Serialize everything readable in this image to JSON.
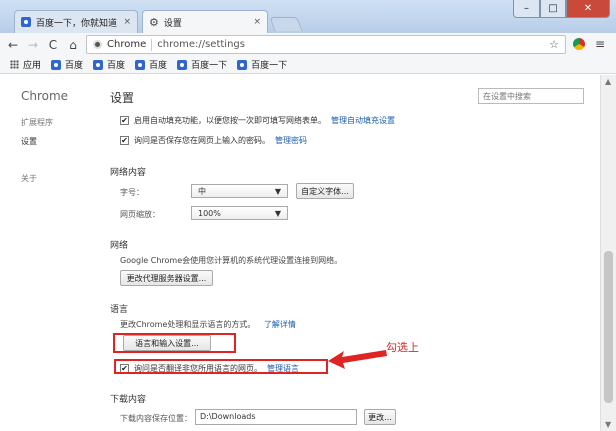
{
  "tabs": [
    {
      "title": "百度一下，你就知道",
      "close": "×",
      "icon": "baidu-paw-icon"
    },
    {
      "title": "设置",
      "close": "×",
      "icon": "gear-icon"
    }
  ],
  "window_controls": {
    "minimize": "–",
    "maximize": "□",
    "close": "✕"
  },
  "toolbar": {
    "back": "←",
    "forward": "→",
    "reload": "C",
    "home": "⌂",
    "site_label": "Chrome",
    "url": "chrome://settings",
    "star": "☆",
    "menu": "≡"
  },
  "bookmarks": {
    "apps": "应用",
    "items": [
      "百度",
      "百度",
      "百度",
      "百度一下",
      "百度一下"
    ]
  },
  "sidebar": {
    "title": "Chrome",
    "items": [
      "扩展程序",
      "设置",
      "关于"
    ]
  },
  "main": {
    "title": "设置",
    "search_placeholder": "在设置中搜索",
    "autofill": {
      "checked": "✔",
      "text": "启用自动填充功能，以便您按一次即可填写网络表单。",
      "link": "管理自动填充设置"
    },
    "passwords": {
      "checked": "✔",
      "text": "询问是否保存您在网页上输入的密码。",
      "link": "管理密码"
    },
    "web_content": {
      "heading": "网络内容",
      "font_size_label": "字号：",
      "font_size_value": "中",
      "customize_fonts": "自定义字体...",
      "zoom_label": "网页缩放：",
      "zoom_value": "100%"
    },
    "network": {
      "heading": "网络",
      "desc": "Google Chrome会使用您计算机的系统代理设置连接到网络。",
      "button": "更改代理服务器设置..."
    },
    "language": {
      "heading": "语言",
      "desc": "更改Chrome处理和显示语言的方式。",
      "link": "了解详情",
      "button": "语言和输入设置...",
      "translate_checked": "✔",
      "translate_text": "询问是否翻译非您所用语言的网页。",
      "translate_link": "管理语言"
    },
    "downloads": {
      "heading": "下载内容",
      "location_label": "下载内容保存位置：",
      "location_value": "D:\\Downloads",
      "change_button": "更改..."
    }
  },
  "annotation": {
    "callout": "勾选上",
    "color": "#e02424"
  }
}
